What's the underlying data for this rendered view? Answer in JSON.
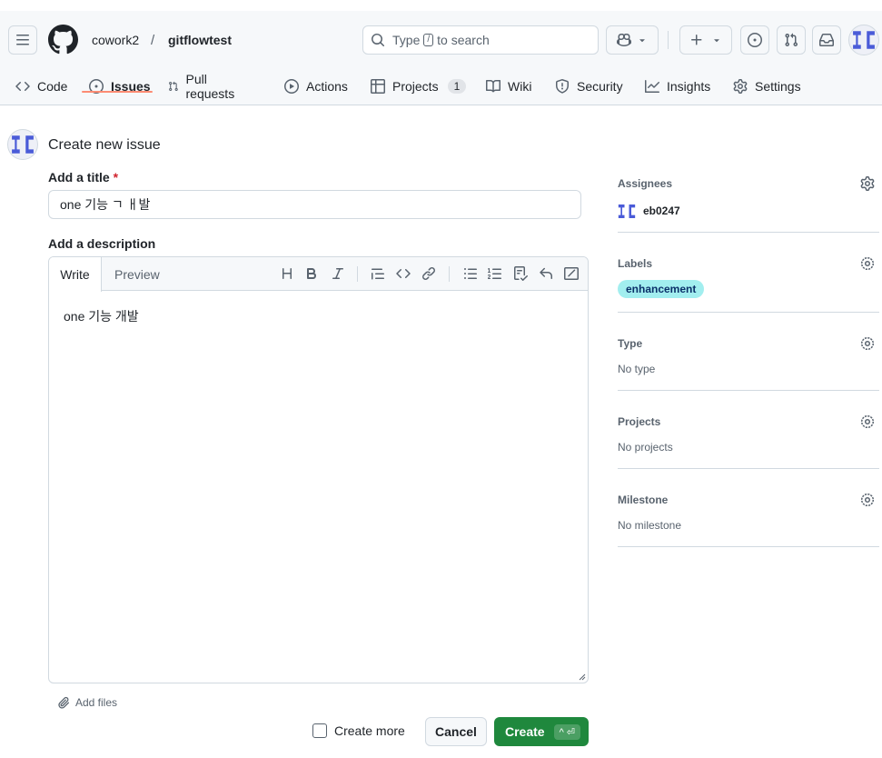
{
  "header": {
    "owner": "cowork2",
    "separator": "/",
    "repo": "gitflowtest",
    "search": {
      "prefix": "Type",
      "key": "/",
      "suffix": "to search"
    }
  },
  "tabs": [
    {
      "label": "Code",
      "icon": "code-icon"
    },
    {
      "label": "Issues",
      "icon": "issue-opened-icon",
      "active": true
    },
    {
      "label": "Pull requests",
      "icon": "git-pull-request-icon"
    },
    {
      "label": "Actions",
      "icon": "play-icon"
    },
    {
      "label": "Projects",
      "icon": "table-icon",
      "count": "1"
    },
    {
      "label": "Wiki",
      "icon": "book-icon"
    },
    {
      "label": "Security",
      "icon": "shield-icon"
    },
    {
      "label": "Insights",
      "icon": "graph-icon"
    },
    {
      "label": "Settings",
      "icon": "gear-icon"
    }
  ],
  "main": {
    "page_title": "Create new issue",
    "title_label": "Add a title",
    "required_mark": "*",
    "title_value": "one 기능 ㄱ ㅐ발",
    "description_label": "Add a description",
    "editor_tabs": {
      "write": "Write",
      "preview": "Preview"
    },
    "description_value": "one 기능 개발",
    "add_files": "Add files",
    "create_more": "Create more",
    "cancel": "Cancel",
    "create": "Create",
    "create_shortcut": "^ ⏎"
  },
  "sidebar": {
    "assignees": {
      "heading": "Assignees",
      "user": "eb0247"
    },
    "labels": {
      "heading": "Labels",
      "label": "enhancement",
      "label_color": "#a2eeef"
    },
    "type": {
      "heading": "Type",
      "value": "No type"
    },
    "projects": {
      "heading": "Projects",
      "value": "No projects"
    },
    "milestone": {
      "heading": "Milestone",
      "value": "No milestone"
    }
  },
  "colors": {
    "accent_green": "#1f883d",
    "tab_underline": "#fd8c73",
    "avatar_blue": "#4a5bd8"
  }
}
